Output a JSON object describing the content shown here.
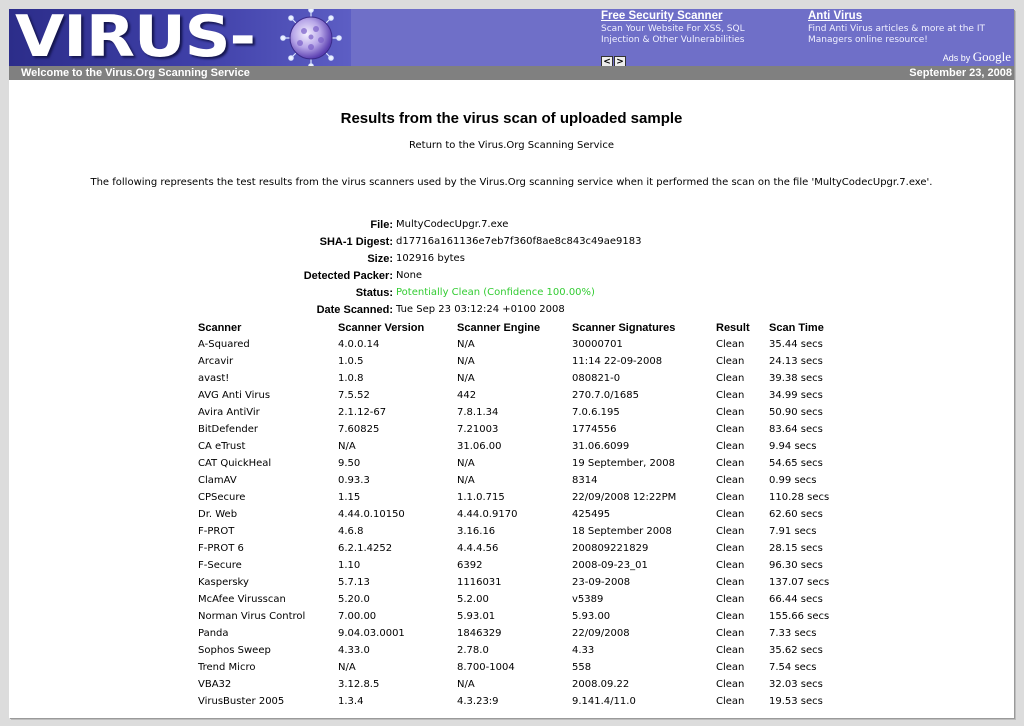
{
  "header": {
    "logo_text": "VIRUS-",
    "ads": [
      {
        "title": "Free Security Scanner",
        "body": "Scan Your Website For XSS, SQL Injection & Other Vulnerabilities"
      },
      {
        "title": "Anti Virus",
        "body": "Find Anti Virus articles & more at the IT Managers online resource!"
      }
    ],
    "nav_prev": "<",
    "nav_next": ">",
    "ads_by": "Ads by",
    "google": "Google"
  },
  "banner": {
    "welcome": "Welcome to the Virus.Org Scanning Service",
    "date": "September 23, 2008"
  },
  "main": {
    "title": "Results from the virus scan of uploaded sample",
    "return_link": "Return to the Virus.Org Scanning Service",
    "intro": "The following represents the test results from the virus scanners used by the Virus.Org scanning service when it performed the scan on the file 'MultyCodecUpgr.7.exe'."
  },
  "file_info": [
    {
      "label": "File:",
      "value": "MultyCodecUpgr.7.exe"
    },
    {
      "label": "SHA-1 Digest:",
      "value": "d17716a161136e7eb7f360f8ae8c843c49ae9183"
    },
    {
      "label": "Size:",
      "value": "102916 bytes"
    },
    {
      "label": "Detected Packer:",
      "value": "None"
    },
    {
      "label": "Status:",
      "value": "Potentially Clean (Confidence 100.00%)"
    },
    {
      "label": "Date Scanned:",
      "value": "Tue Sep 23 03:12:24 +0100 2008"
    }
  ],
  "status_color": "#33cc33",
  "results": {
    "headers": [
      "Scanner",
      "Scanner Version",
      "Scanner Engine",
      "Scanner Signatures",
      "Result",
      "Scan Time"
    ],
    "rows": [
      [
        "A-Squared",
        "4.0.0.14",
        "N/A",
        "30000701",
        "Clean",
        "35.44 secs"
      ],
      [
        "Arcavir",
        "1.0.5",
        "N/A",
        "11:14 22-09-2008",
        "Clean",
        "24.13 secs"
      ],
      [
        "avast!",
        "1.0.8",
        "N/A",
        "080821-0",
        "Clean",
        "39.38 secs"
      ],
      [
        "AVG Anti Virus",
        "7.5.52",
        "442",
        "270.7.0/1685",
        "Clean",
        "34.99 secs"
      ],
      [
        "Avira AntiVir",
        "2.1.12-67",
        "7.8.1.34",
        "7.0.6.195",
        "Clean",
        "50.90 secs"
      ],
      [
        "BitDefender",
        "7.60825",
        "7.21003",
        "1774556",
        "Clean",
        "83.64 secs"
      ],
      [
        "CA eTrust",
        "N/A",
        "31.06.00",
        "31.06.6099",
        "Clean",
        "9.94 secs"
      ],
      [
        "CAT QuickHeal",
        "9.50",
        "N/A",
        "19 September, 2008",
        "Clean",
        "54.65 secs"
      ],
      [
        "ClamAV",
        "0.93.3",
        "N/A",
        "8314",
        "Clean",
        "0.99 secs"
      ],
      [
        "CPSecure",
        "1.15",
        "1.1.0.715",
        "22/09/2008 12:22PM",
        "Clean",
        "110.28 secs"
      ],
      [
        "Dr. Web",
        "4.44.0.10150",
        "4.44.0.9170",
        "425495",
        "Clean",
        "62.60 secs"
      ],
      [
        "F-PROT",
        "4.6.8",
        "3.16.16",
        "18 September 2008",
        "Clean",
        "7.91 secs"
      ],
      [
        "F-PROT 6",
        "6.2.1.4252",
        "4.4.4.56",
        "200809221829",
        "Clean",
        "28.15 secs"
      ],
      [
        "F-Secure",
        "1.10",
        "6392",
        "2008-09-23_01",
        "Clean",
        "96.30 secs"
      ],
      [
        "Kaspersky",
        "5.7.13",
        "1116031",
        "23-09-2008",
        "Clean",
        "137.07 secs"
      ],
      [
        "McAfee Virusscan",
        "5.20.0",
        "5.2.00",
        "v5389",
        "Clean",
        "66.44 secs"
      ],
      [
        "Norman Virus Control",
        "7.00.00",
        "5.93.01",
        "5.93.00",
        "Clean",
        "155.66 secs"
      ],
      [
        "Panda",
        "9.04.03.0001",
        "1846329",
        "22/09/2008",
        "Clean",
        "7.33 secs"
      ],
      [
        "Sophos Sweep",
        "4.33.0",
        "2.78.0",
        "4.33",
        "Clean",
        "35.62 secs"
      ],
      [
        "Trend Micro",
        "N/A",
        "8.700-1004",
        "558",
        "Clean",
        "7.54 secs"
      ],
      [
        "VBA32",
        "3.12.8.5",
        "N/A",
        "2008.09.22",
        "Clean",
        "32.03 secs"
      ],
      [
        "VirusBuster 2005",
        "1.3.4",
        "4.3.23:9",
        "9.141.4/11.0",
        "Clean",
        "19.53 secs"
      ]
    ]
  }
}
